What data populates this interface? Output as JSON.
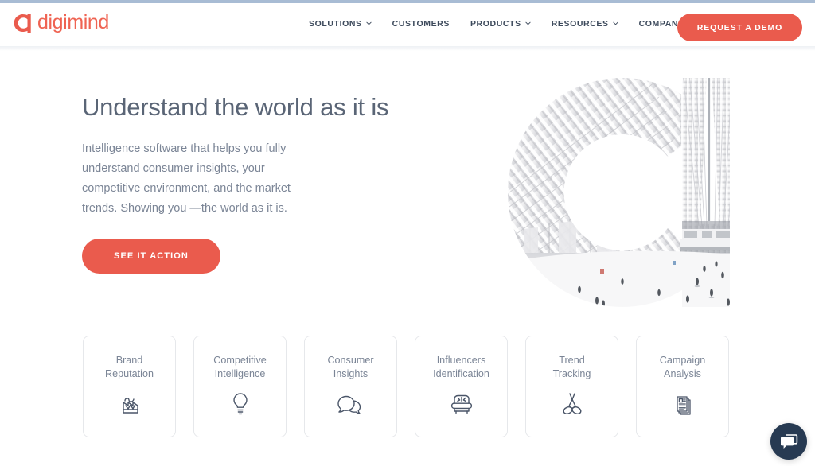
{
  "brand": {
    "logo_text": "digimind",
    "logo_mark": "digimind-d-hook-icon",
    "accent_color": "#ea5b4d",
    "text_color": "#3d4a5c",
    "muted_color": "#7b8596"
  },
  "header": {
    "nav": [
      {
        "label": "SOLUTIONS",
        "has_dropdown": true,
        "name": "solutions"
      },
      {
        "label": "CUSTOMERS",
        "has_dropdown": false,
        "name": "customers"
      },
      {
        "label": "PRODUCTS",
        "has_dropdown": true,
        "name": "products"
      },
      {
        "label": "RESOURCES",
        "has_dropdown": true,
        "name": "resources"
      },
      {
        "label": "COMPANY",
        "has_dropdown": true,
        "name": "company"
      }
    ],
    "cta_label": "REQUEST A DEMO"
  },
  "hero": {
    "title": "Understand the world as it is",
    "subtitle": "Intelligence software that helps you fully understand consumer insights, your competitive environment, and the market trends. Showing you —the world as it is.",
    "cta_label": "SEE IT ACTION",
    "image_alt": "oculus-transit-hub-photo-masked-in-d-logo"
  },
  "cards": [
    {
      "label": "Brand\nReputation",
      "icon": "factory-chart-icon"
    },
    {
      "label": "Competitive\nIntelligence",
      "icon": "lightbulb-icon"
    },
    {
      "label": "Consumer\nInsights",
      "icon": "speech-bubbles-icon"
    },
    {
      "label": "Influencers\nIdentification",
      "icon": "armchair-icon"
    },
    {
      "label": "Trend\nTracking",
      "icon": "crossed-rackets-icon"
    },
    {
      "label": "Campaign\nAnalysis",
      "icon": "stacked-documents-icon"
    }
  ],
  "chat": {
    "icon": "chat-bubbles-icon",
    "bg_color": "#273a52"
  }
}
